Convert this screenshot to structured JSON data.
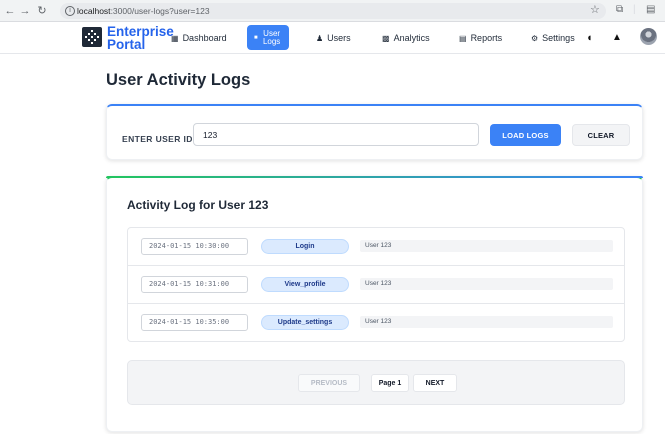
{
  "browser": {
    "url_host": "localhost",
    "url_path": ":3000/user-logs?user=123",
    "back_icon": "arrow-left-icon",
    "forward_icon": "arrow-right-icon",
    "reload_icon": "reload-icon"
  },
  "nav": {
    "brand_line1": "Enterprise",
    "brand_line2": "Portal",
    "items": [
      {
        "label": "Dashboard",
        "icon": "grid-icon"
      },
      {
        "label_line1": "User",
        "label_line2": "Logs",
        "icon": "list-icon",
        "active": true
      },
      {
        "label": "Users",
        "icon": "users-icon"
      },
      {
        "label": "Analytics",
        "icon": "chart-icon"
      },
      {
        "label": "Reports",
        "icon": "document-icon"
      },
      {
        "label": "Settings",
        "icon": "gear-icon"
      }
    ]
  },
  "page": {
    "title": "User Activity Logs"
  },
  "search": {
    "label": "ENTER USER ID:",
    "value": "123",
    "load_label": "LOAD LOGS",
    "clear_label": "CLEAR"
  },
  "logs": {
    "title": "Activity Log for User 123",
    "rows": [
      {
        "timestamp": "2024-01-15 10:30:00",
        "action": "Login",
        "user": "User 123"
      },
      {
        "timestamp": "2024-01-15 10:31:00",
        "action": "View_profile",
        "user": "User 123"
      },
      {
        "timestamp": "2024-01-15 10:35:00",
        "action": "Update_settings",
        "user": "User 123"
      }
    ]
  },
  "pagination": {
    "prev_label": "PREVIOUS",
    "page_label": "Page 1",
    "next_label": "NEXT"
  },
  "colors": {
    "accent": "#3b82f6",
    "brand": "#2563eb"
  }
}
